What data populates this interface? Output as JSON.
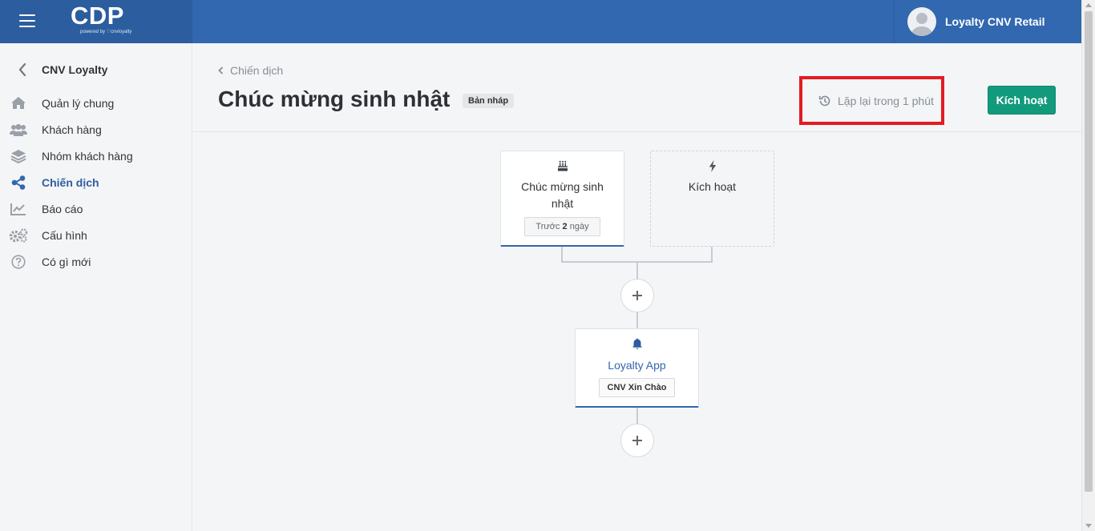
{
  "app": {
    "logo_text": "CDP",
    "logo_sub": "powered by ♡cnvloyalty",
    "user_name": "Loyalty CNV Retail"
  },
  "sidebar": {
    "header": "CNV Loyalty",
    "items": [
      {
        "label": "Quản lý chung",
        "icon": "home-icon",
        "active": false
      },
      {
        "label": "Khách hàng",
        "icon": "users-icon",
        "active": false
      },
      {
        "label": "Nhóm khách hàng",
        "icon": "layers-icon",
        "active": false
      },
      {
        "label": "Chiến dịch",
        "icon": "share-icon",
        "active": true
      },
      {
        "label": "Báo cáo",
        "icon": "chart-line-icon",
        "active": false
      },
      {
        "label": "Cấu hình",
        "icon": "gears-icon",
        "active": false
      },
      {
        "label": "Có gì mới",
        "icon": "question-circle-icon",
        "active": false
      }
    ]
  },
  "page": {
    "breadcrumb": "Chiến dịch",
    "title": "Chúc mừng sinh nhật",
    "status_badge": "Bản nháp",
    "autosave_text": "Lặp lại trong 1 phút",
    "activate_label": "Kích hoạt"
  },
  "flow": {
    "trigger": {
      "icon": "birthday-cake-icon",
      "title": "Chúc mừng sinh nhật",
      "chip_prefix": "Trước",
      "chip_value": "2",
      "chip_suffix": "ngày"
    },
    "add_trigger": {
      "icon": "bolt-icon",
      "title": "Kích hoạt"
    },
    "action": {
      "icon": "bell-icon",
      "title": "Loyalty App",
      "chip": "CNV Xin Chào"
    }
  },
  "colors": {
    "header_bg": "#3168b0",
    "brand_bg": "#2c5d9f",
    "accent_green": "#129a7d",
    "highlight_red": "#e31b23",
    "link_blue": "#3168b0"
  }
}
